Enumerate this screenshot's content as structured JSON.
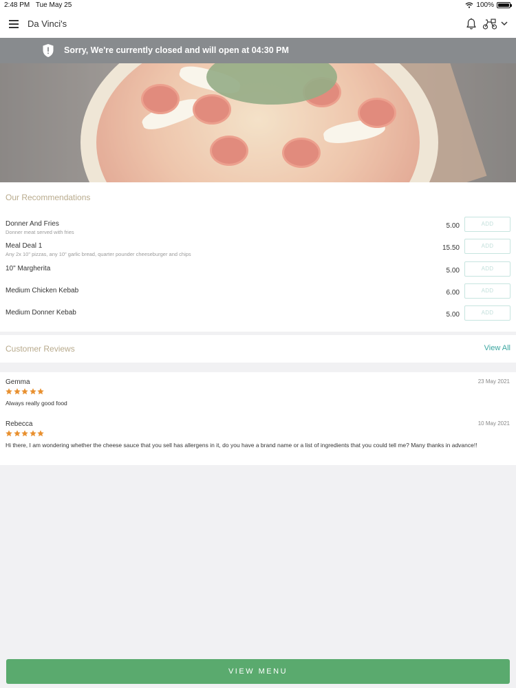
{
  "status_bar": {
    "time": "2:48 PM",
    "date": "Tue May 25",
    "battery": "100%",
    "icons": [
      "wifi-icon",
      "battery-icon"
    ]
  },
  "nav": {
    "title": "Da Vinci's",
    "icons": [
      "menu-icon",
      "bell-icon",
      "delivery-icon",
      "chevron-down-icon"
    ]
  },
  "banner": {
    "text": "Sorry, We're currently closed and will open at 04:30 PM",
    "icon": "shield-icon"
  },
  "recommendations": {
    "title": "Our Recommendations",
    "add_label": "ADD",
    "items": [
      {
        "name": "Donner And Fries",
        "description": "Donner meat served with fries",
        "price": "5.00"
      },
      {
        "name": "Meal Deal 1",
        "description": "Any 2x 10\" pizzas, any 10\" garlic bread, quarter pounder cheeseburger and chips",
        "price": "15.50"
      },
      {
        "name": "10\" Margherita",
        "description": "",
        "price": "5.00"
      },
      {
        "name": "Medium Chicken Kebab",
        "description": "",
        "price": "6.00"
      },
      {
        "name": "Medium Donner Kebab",
        "description": "",
        "price": "5.00"
      }
    ]
  },
  "reviews": {
    "title": "Customer Reviews",
    "view_all": "View All",
    "items": [
      {
        "name": "Gemma",
        "date": "23 May 2021",
        "rating": 5,
        "text": "Always really good food"
      },
      {
        "name": "Rebecca",
        "date": "10 May 2021",
        "rating": 5,
        "text": "Hi there, I am wondering whether the cheese sauce that you sell has allergens in it, do you have a brand name or a list of ingredients that you could tell me? Many thanks in advance!!"
      }
    ]
  },
  "footer": {
    "view_menu": "VIEW MENU"
  },
  "colors": {
    "accent": "#3aa6a0",
    "primary_button": "#5aaa6e",
    "banner": "#888b8e",
    "section_title": "#b8aa8c",
    "star": "#e8902f"
  }
}
